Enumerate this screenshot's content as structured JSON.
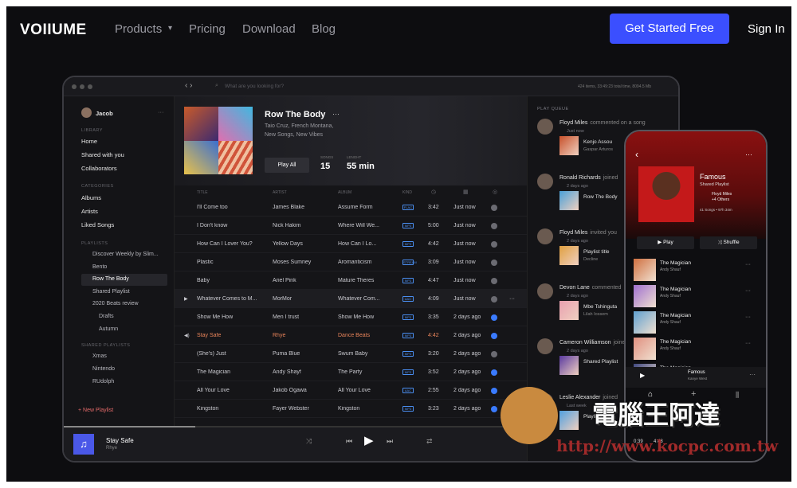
{
  "site": {
    "logo": "VOIIUME",
    "nav": [
      "Products",
      "Pricing",
      "Download",
      "Blog"
    ],
    "cta": "Get Started Free",
    "signin": "Sign In"
  },
  "app": {
    "search_placeholder": "What are you looking for?",
    "status": "424 items, 33:49:23 total time, 8094.5 Mb",
    "user": "Jacob",
    "library_label": "LIBRARY",
    "library": [
      "Home",
      "Shared with you",
      "Collaborators"
    ],
    "categories_label": "CATEGORIES",
    "categories": [
      "Albums",
      "Artists",
      "Liked Songs"
    ],
    "playlists_label": "PLAYLISTS",
    "playlists": [
      "Discover Weekly by Slim...",
      "Bento",
      "Row The Body",
      "Shared Playlist",
      "2020 Beats review",
      "Drafts",
      "Autumn"
    ],
    "shared_label": "SHARED PLAYLISTS",
    "shared": [
      "Xmas",
      "Nintendo",
      "RUdolph"
    ],
    "new_playlist": "+ New Playlist",
    "album": {
      "title": "Row The Body",
      "artists": "Taio Cruz, French Montana,",
      "tags": "New Songs, New Vibes",
      "play": "Play All",
      "songs_label": "SONGS",
      "songs": "15",
      "length_label": "LENGHT",
      "length": "55 min"
    },
    "cols": [
      "TITLE",
      "ARTIST",
      "ALBUM",
      "KIND"
    ],
    "tracks": [
      {
        "t": "I'll Come too",
        "a": "James Blake",
        "al": "Assume Form",
        "k": "FLAC",
        "d": "3:42",
        "w": "Just now",
        "c": false
      },
      {
        "t": "I Don't know",
        "a": "Nick Hakim",
        "al": "Where Will We...",
        "k": "MP3",
        "d": "5:00",
        "w": "Just now",
        "c": false
      },
      {
        "t": "How Can I Lover You?",
        "a": "Yellow Days",
        "al": "How Can I Lo...",
        "k": "MP3",
        "d": "4:42",
        "w": "Just now",
        "c": false
      },
      {
        "t": "Plastic",
        "a": "Moses Sumney",
        "al": "Aromanticism",
        "k": "STREAM",
        "d": "3:09",
        "w": "Just now",
        "c": false
      },
      {
        "t": "Baby",
        "a": "Ariel Pink",
        "al": "Mature Theres",
        "k": "MP3",
        "d": "4:47",
        "w": "Just now",
        "c": false
      },
      {
        "t": "Whatever Comes to M...",
        "a": "MorMor",
        "al": "Whatever Com...",
        "k": "AAC",
        "d": "4:09",
        "w": "Just now",
        "c": false
      },
      {
        "t": "Show Me How",
        "a": "Men I trust",
        "al": "Show Me How",
        "k": "MP3",
        "d": "3:35",
        "w": "2 days ago",
        "c": true
      },
      {
        "t": "Stay Safe",
        "a": "Rhye",
        "al": "Dance Beats",
        "k": "MP3",
        "d": "4:42",
        "w": "2 days ago",
        "c": true
      },
      {
        "t": "(She's) Just",
        "a": "Puma Blue",
        "al": "Swum Baby",
        "k": "MP3",
        "d": "3:20",
        "w": "2 days ago",
        "c": false
      },
      {
        "t": "The Magician",
        "a": "Andy Shayf",
        "al": "The Party",
        "k": "MP3",
        "d": "3:52",
        "w": "2 days ago",
        "c": true
      },
      {
        "t": "All Your Love",
        "a": "Jakob Ogawa",
        "al": "All Your Love",
        "k": "AAC",
        "d": "2:55",
        "w": "2 days ago",
        "c": true
      },
      {
        "t": "Kingston",
        "a": "Fayer Webster",
        "al": "Kingston",
        "k": "MP3",
        "d": "3:23",
        "w": "2 days ago",
        "c": true
      }
    ],
    "queue_label": "PLAY QUEUE",
    "queue": [
      {
        "n": "Floyd Miles",
        "v": "commented on a song",
        "time": "Just now",
        "track": "Kenjo Assou",
        "sub": "Gaspar Arturos"
      },
      {
        "n": "Ronald Richards",
        "v": "joined",
        "time": "2 days ago",
        "track": "Row The Body",
        "sub": ""
      },
      {
        "n": "Floyd Miles",
        "v": "invited you",
        "time": "2 days ago",
        "track": "Playlist title",
        "sub": "Decline"
      },
      {
        "n": "Devon Lane",
        "v": "commented",
        "time": "2 days ago",
        "track": "Mbe Tshinguta",
        "sub": "Lilah Iossem"
      },
      {
        "n": "Cameron Williamson",
        "v": "joined",
        "time": "2 days ago",
        "track": "Shared Playlist",
        "sub": ""
      },
      {
        "n": "Leslie Alexander",
        "v": "joined",
        "time": "Last week",
        "track": "Playlist title",
        "sub": ""
      }
    ],
    "now": {
      "title": "Stay Safe",
      "artist": "Rhye"
    }
  },
  "phone": {
    "title": "Famous",
    "sub": "Shared Playlist",
    "owner": "Floyd Miles",
    "others": "+4 Others",
    "meta": "41 Songs • 97h 34m",
    "play": "Play",
    "shuffle": "Shuffle",
    "rows": [
      {
        "t": "The Magician",
        "a": "Andy Shauf"
      },
      {
        "t": "The Magician",
        "a": "Andy Shauf"
      },
      {
        "t": "The Magician",
        "a": "Andy Shauf"
      },
      {
        "t": "The Magician",
        "a": "Andy Shauf"
      },
      {
        "t": "The Magician",
        "a": "Andy Shauf"
      }
    ],
    "now": {
      "t": "Famous",
      "a": "Kanye West"
    },
    "time_a": "0:39",
    "time_b": "4:48"
  },
  "watermark": {
    "cn": "電腦王阿達",
    "url": "http://www.kocpc.com.tw"
  }
}
